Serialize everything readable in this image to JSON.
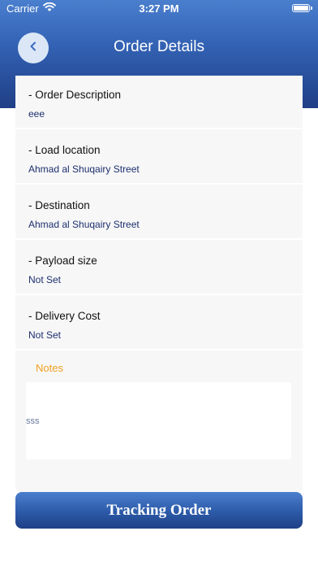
{
  "status_bar": {
    "carrier": "Carrier",
    "time": "3:27 PM"
  },
  "header": {
    "title": "Order Details",
    "back_icon": "chevron-left-icon"
  },
  "sections": [
    {
      "label": "- Order Description",
      "value": "eee"
    },
    {
      "label": "- Load location",
      "value": "Ahmad al Shuqairy Street"
    },
    {
      "label": "- Destination",
      "value": "Ahmad al Shuqairy Street"
    },
    {
      "label": "- Payload size",
      "value": "Not Set"
    },
    {
      "label": "- Delivery Cost",
      "value": "Not Set"
    }
  ],
  "notes": {
    "label": "Notes",
    "value": "sss"
  },
  "footer": {
    "tracking_button_label": "Tracking Order"
  },
  "colors": {
    "header_gradient_top": "#4a7fce",
    "header_gradient_bottom": "#1f3f86",
    "value_text": "#1c2f6e",
    "notes_label": "#f0a020",
    "card_background": "#f7f7f7"
  }
}
